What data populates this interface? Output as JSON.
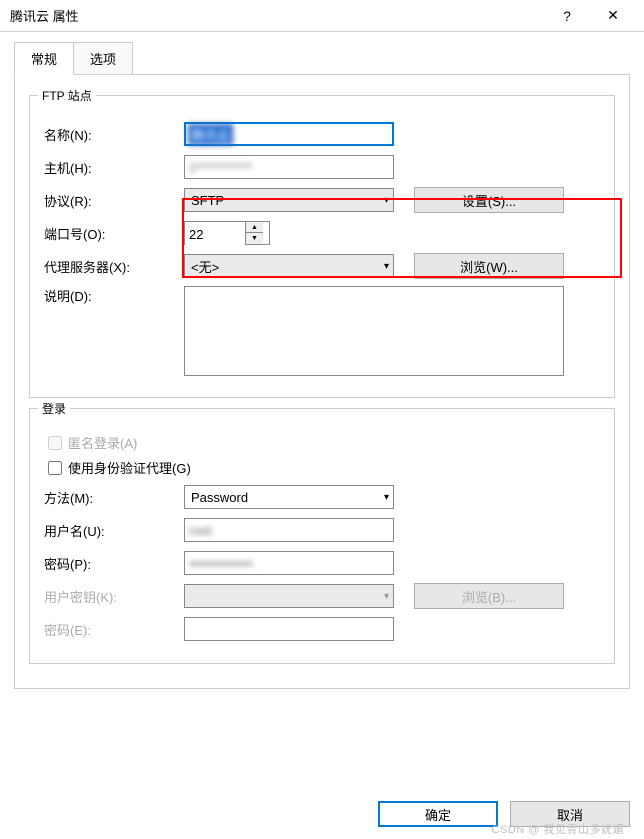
{
  "window": {
    "title": "腾讯云 属性",
    "help_icon": "?",
    "close_icon": "✕"
  },
  "tabs": {
    "general": "常规",
    "options": "选项"
  },
  "groups": {
    "ftp": "FTP 站点",
    "login": "登录"
  },
  "ftp": {
    "name_label": "名称(N):",
    "name_value": "腾讯云",
    "host_label": "主机(H):",
    "host_value": "1***********",
    "protocol_label": "协议(R):",
    "protocol_value": "SFTP",
    "settings_btn": "设置(S)...",
    "port_label": "端口号(O):",
    "port_value": "22",
    "proxy_label": "代理服务器(X):",
    "proxy_value": "<无>",
    "browse_btn": "浏览(W)...",
    "desc_label": "说明(D):",
    "desc_value": ""
  },
  "login": {
    "anon_label": "匿名登录(A)",
    "auth_agent_label": "使用身份验证代理(G)",
    "method_label": "方法(M):",
    "method_value": "Password",
    "user_label": "用户名(U):",
    "user_value": "root",
    "pwd_label": "密码(P):",
    "pwd_value": "••••••••••••••",
    "key_label": "用户密钥(K):",
    "browse_btn": "浏览(B)...",
    "keypwd_label": "密码(E):"
  },
  "buttons": {
    "ok": "确定",
    "cancel": "取消"
  },
  "watermark": "CSDN @ 我见青山多妩媚"
}
